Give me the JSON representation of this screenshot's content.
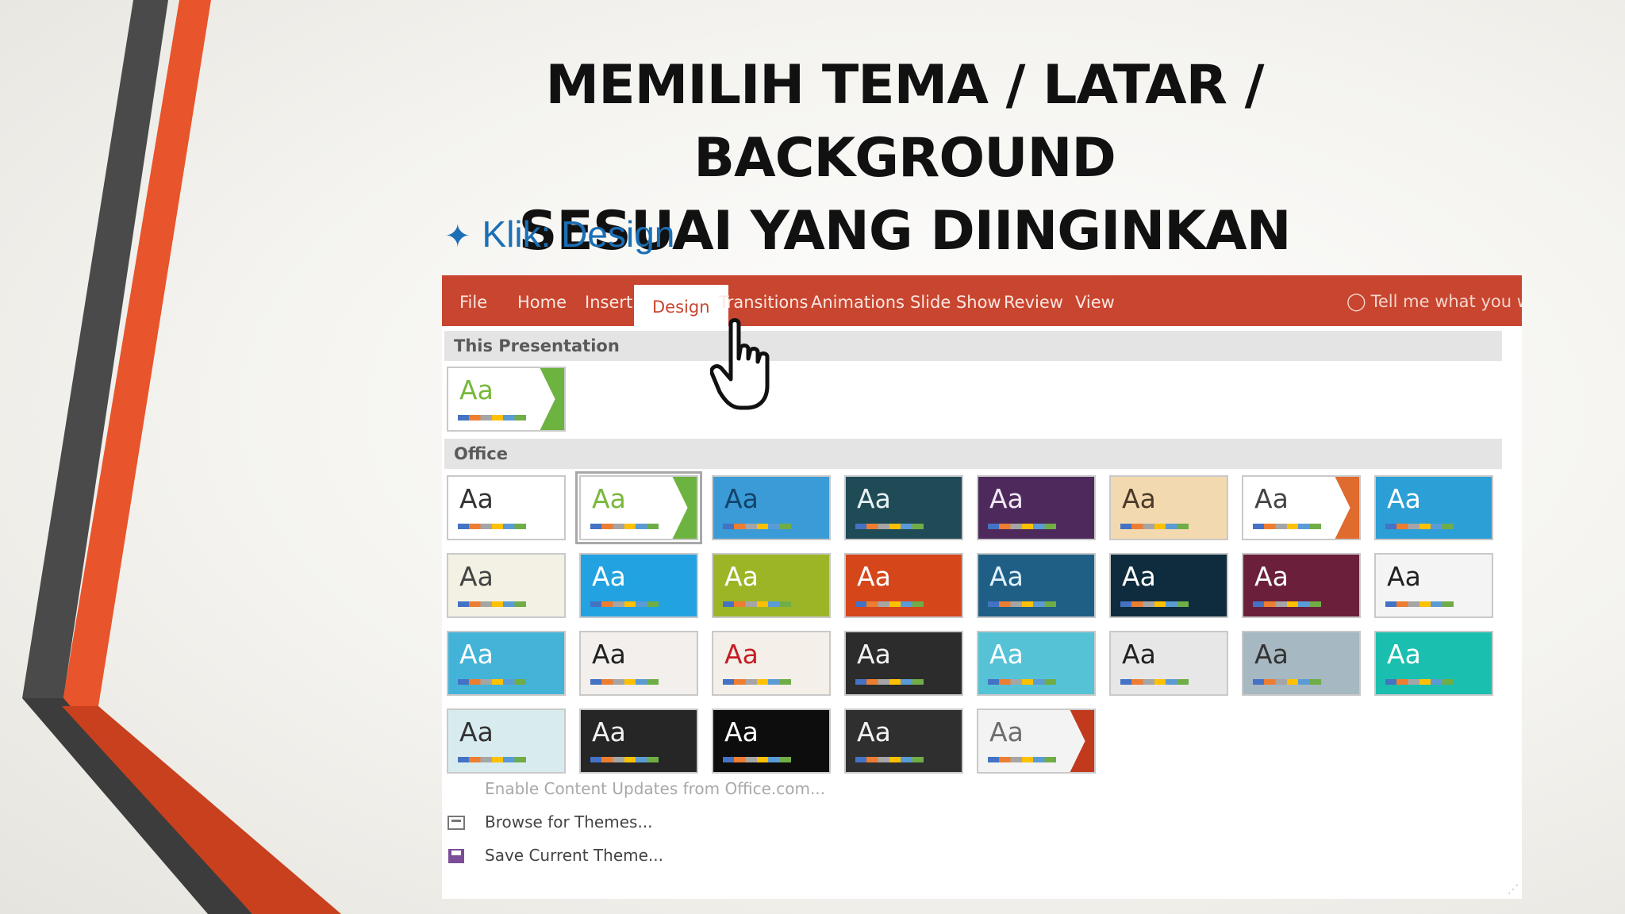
{
  "slide": {
    "title_line1": "MEMILIH TEMA / LATAR / BACKGROUND",
    "title_line2": "SESUAI YANG DIINGINKAN",
    "bullet": "Klik: Design",
    "accent_color": "#e8542b"
  },
  "ribbon": {
    "color": "#c8452f",
    "tabs": [
      {
        "label": "File"
      },
      {
        "label": "Home"
      },
      {
        "label": "Insert"
      },
      {
        "label": "Design",
        "active": true
      },
      {
        "label": "Transitions"
      },
      {
        "label": "Animations"
      },
      {
        "label": "Slide Show"
      },
      {
        "label": "Review"
      },
      {
        "label": "View"
      }
    ],
    "tell_me": "Tell me what you wa",
    "tell_me_icon": "lightbulb-icon"
  },
  "gallery": {
    "section_this": "This Presentation",
    "section_office": "Office",
    "aa_label": "Aa",
    "themes_this": [
      {
        "name": "facet-green",
        "bg": "#ffffff",
        "fg": "#78b83a",
        "accent": "#6db33f"
      }
    ],
    "themes_office": [
      {
        "name": "office-theme",
        "bg": "#ffffff",
        "fg": "#333333"
      },
      {
        "name": "facet",
        "bg": "#ffffff",
        "fg": "#78b83a",
        "accent": "#6db33f",
        "selected": true
      },
      {
        "name": "integral-pattern",
        "bg": "#3a9bd6",
        "fg": "#13446a"
      },
      {
        "name": "ion-boardroom",
        "bg": "#1f4b57",
        "fg": "#e8f1f2"
      },
      {
        "name": "ion-purple",
        "bg": "#4e2a5c",
        "fg": "#f1e8f4"
      },
      {
        "name": "organic",
        "bg": "#f3d9b0",
        "fg": "#4a3a2a"
      },
      {
        "name": "retrospect",
        "bg": "#ffffff",
        "fg": "#444444",
        "accent": "#e06b2e"
      },
      {
        "name": "slice-blue",
        "bg": "#2b9fd6",
        "fg": "#ffffff"
      },
      {
        "name": "wisp",
        "bg": "#f3f1e3",
        "fg": "#444444"
      },
      {
        "name": "banded",
        "bg": "#22a2e0",
        "fg": "#ffffff"
      },
      {
        "name": "basis-green",
        "bg": "#9bb527",
        "fg": "#ffffff"
      },
      {
        "name": "berlin",
        "bg": "#d5461b",
        "fg": "#ffffff"
      },
      {
        "name": "circuit",
        "bg": "#1f5f86",
        "fg": "#dff1fb"
      },
      {
        "name": "damask",
        "bg": "#0e2c3d",
        "fg": "#ffffff"
      },
      {
        "name": "depth",
        "bg": "#6b1f3b",
        "fg": "#ffffff"
      },
      {
        "name": "dividend",
        "bg": "#f4f4f4",
        "fg": "#222222"
      },
      {
        "name": "droplet",
        "bg": "#44b3d8",
        "fg": "#ffffff"
      },
      {
        "name": "frame",
        "bg": "#f2efec",
        "fg": "#222222"
      },
      {
        "name": "gallery-red",
        "bg": "#f4efe8",
        "fg": "#c41e25"
      },
      {
        "name": "mesh",
        "bg": "#2c2c2c",
        "fg": "#f2f2f2"
      },
      {
        "name": "parallax",
        "bg": "#55c2d6",
        "fg": "#ffffff"
      },
      {
        "name": "savon",
        "bg": "#e7e7e7",
        "fg": "#222222"
      },
      {
        "name": "slate",
        "bg": "#a6b8c1",
        "fg": "#333333"
      },
      {
        "name": "quotable",
        "bg": "#1bbfaf",
        "fg": "#ffffff"
      },
      {
        "name": "crop",
        "bg": "#d8ecef",
        "fg": "#333333"
      },
      {
        "name": "main-event",
        "bg": "#262626",
        "fg": "#f2f2f2"
      },
      {
        "name": "vapor-trail",
        "bg": "#0d0d0d",
        "fg": "#ffffff"
      },
      {
        "name": "view",
        "bg": "#2f2f2f",
        "fg": "#f2f2f2"
      },
      {
        "name": "wood-type",
        "bg": "#f3f3f3",
        "fg": "#6e6e6e",
        "accent": "#c23a1e"
      }
    ]
  },
  "commands": [
    {
      "label": "Enable Content Updates from Office.com...",
      "disabled": true,
      "icon": ""
    },
    {
      "label": "Browse for Themes...",
      "disabled": false,
      "icon": "folder-icon"
    },
    {
      "label": "Save Current Theme...",
      "disabled": false,
      "icon": "save-icon"
    }
  ]
}
